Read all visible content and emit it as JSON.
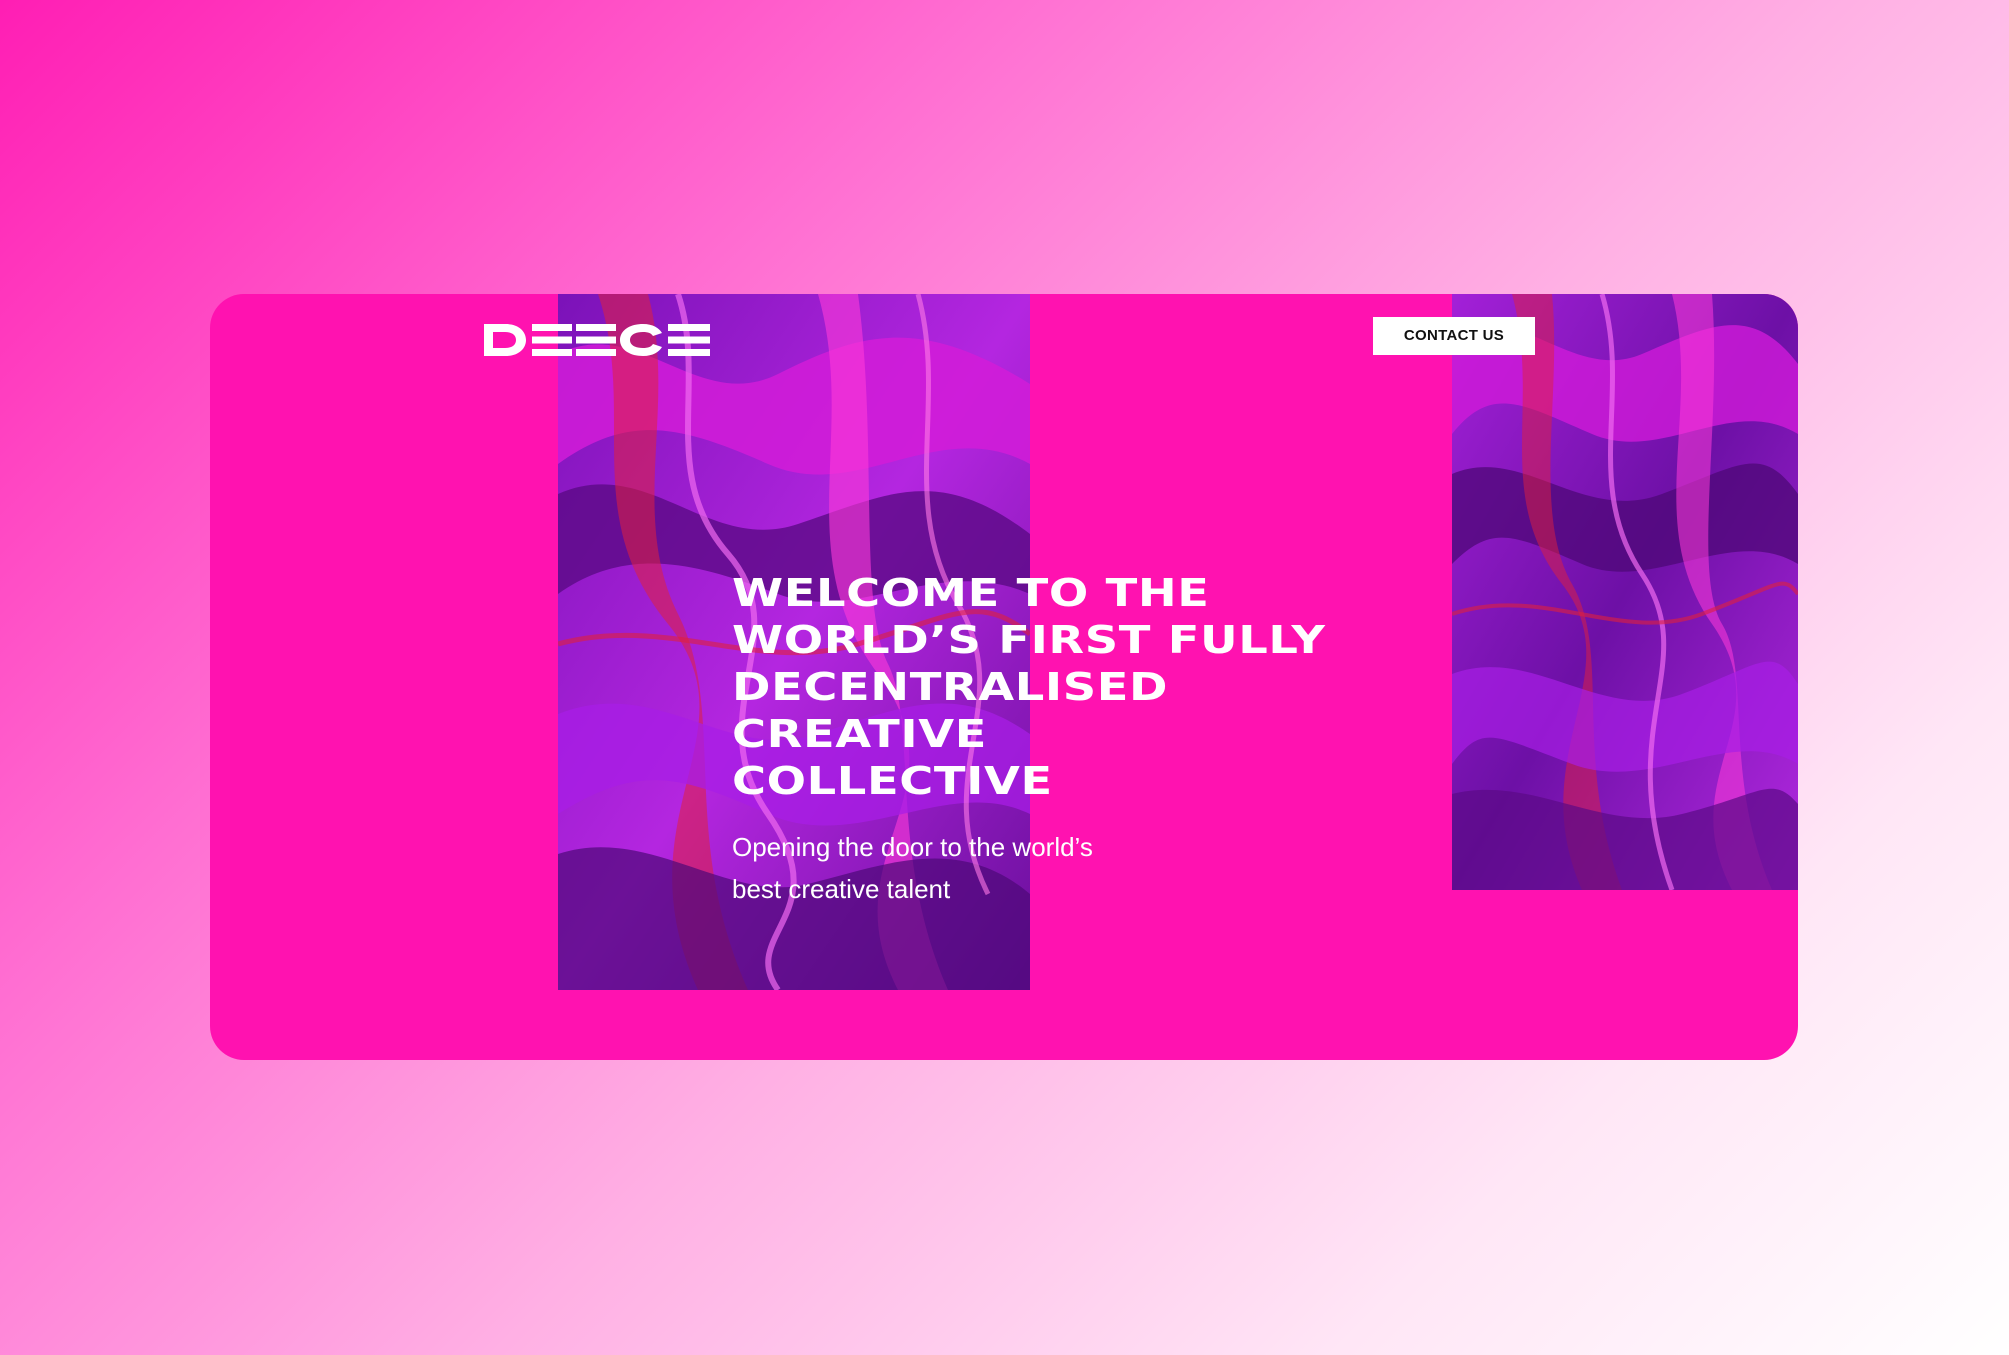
{
  "brand": {
    "logo_text": "DEECE"
  },
  "header": {
    "contact_label": "CONTACT US"
  },
  "hero": {
    "title_lines": [
      "WELCOME TO THE",
      "WORLD’S FIRST FULLY",
      "DECENTRALISED",
      "CREATIVE",
      "COLLECTIVE"
    ],
    "subtitle_lines": [
      "Opening the door to the world’s",
      "best creative talent"
    ]
  },
  "colors": {
    "card_background": "#ff12b0",
    "text": "#ffffff",
    "button_background": "#ffffff",
    "button_text": "#111111",
    "marble_deep": "#5b0a86",
    "marble_violet": "#9b1fd6",
    "marble_magenta": "#d01ad8",
    "marble_red": "#e0203e"
  },
  "icons": {
    "logo": "deece-wordmark"
  }
}
